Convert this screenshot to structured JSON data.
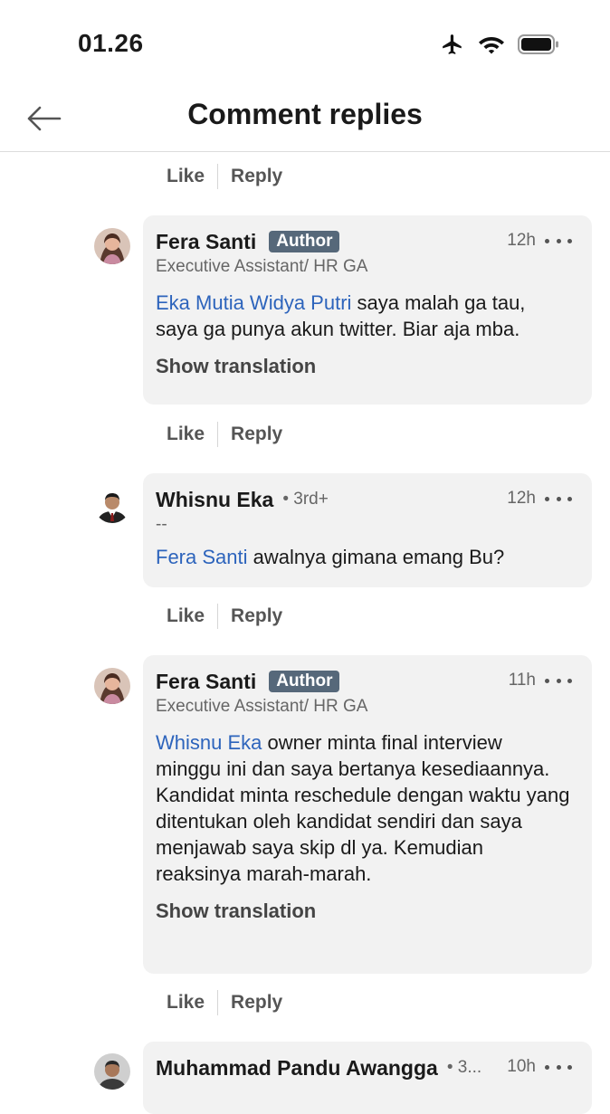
{
  "status_bar": {
    "time": "01.26"
  },
  "header": {
    "title": "Comment replies"
  },
  "actions": {
    "like": "Like",
    "reply": "Reply"
  },
  "comments": [
    {
      "name": "Fera Santi",
      "badge": "Author",
      "time": "12h",
      "subtitle": "Executive Assistant/ HR GA",
      "mention": "Eka Mutia Widya Putri",
      "text": " saya malah ga tau, saya ga punya akun twitter. Biar aja mba.",
      "show_translation": "Show translation"
    },
    {
      "name": "Whisnu Eka",
      "degree": "• 3rd+",
      "time": "12h",
      "subtitle": "--",
      "mention": "Fera Santi",
      "text": " awalnya gimana emang Bu?"
    },
    {
      "name": "Fera Santi",
      "badge": "Author",
      "time": "11h",
      "subtitle": "Executive Assistant/ HR GA",
      "mention": "Whisnu Eka",
      "text": " owner minta final interview minggu ini dan saya bertanya kesediaannya. Kandidat minta reschedule dengan waktu yang ditentukan oleh kandidat sendiri dan saya menjawab saya skip dl ya. Kemudian reaksinya marah-marah.",
      "show_translation": "Show translation"
    },
    {
      "name": "Muhammad Pandu Awangga",
      "degree": "• 3...",
      "time": "10h"
    }
  ]
}
